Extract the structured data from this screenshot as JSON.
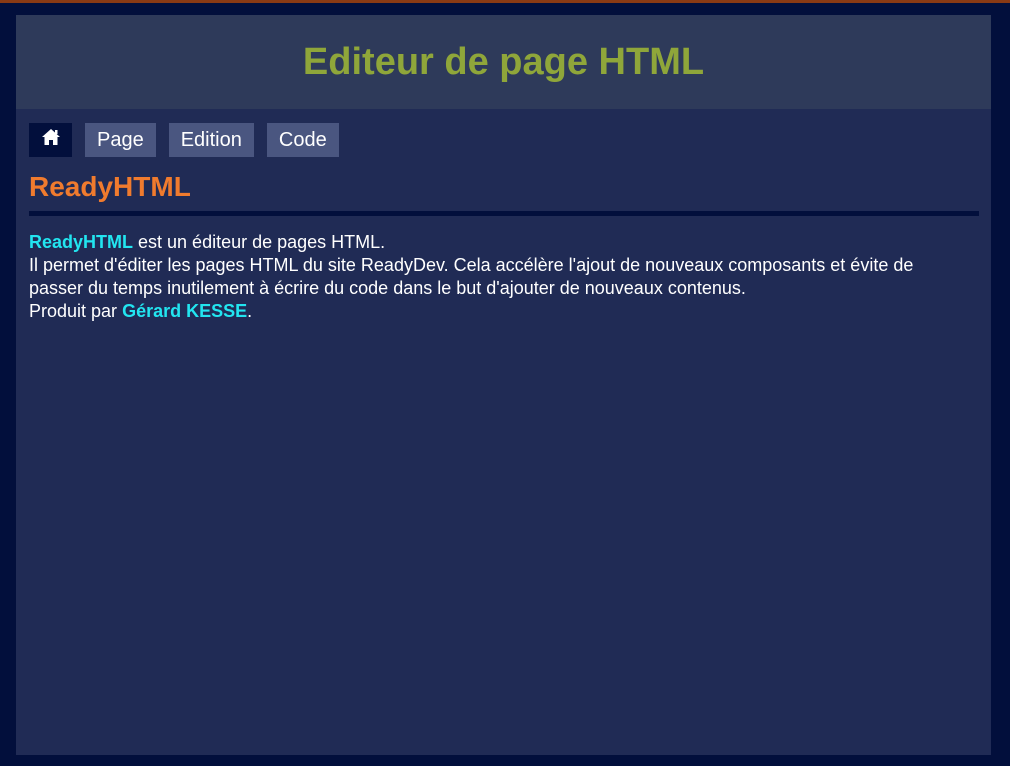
{
  "header": {
    "title": "Editeur de page HTML"
  },
  "nav": {
    "home_icon": "home-icon",
    "items": [
      {
        "label": "Page"
      },
      {
        "label": "Edition"
      },
      {
        "label": "Code"
      }
    ]
  },
  "main": {
    "section_title": "ReadyHTML",
    "intro": {
      "product_name": "ReadyHTML",
      "rest": " est un éditeur de pages HTML."
    },
    "description": "Il permet d'éditer les pages HTML du site ReadyDev. Cela accélère l'ajout de nouveaux composants et évite de passer du temps inutilement à écrire du code dans le but d'ajouter de nouveaux contenus.",
    "credits": {
      "prefix": "Produit par ",
      "author": "Gérard KESSE",
      "suffix": "."
    }
  },
  "colors": {
    "background": "#020f3c",
    "panel": "#202b55",
    "header": "#2e3a5a",
    "title": "#8fa63a",
    "section_title": "#f07b2e",
    "highlight": "#22e5f0",
    "nav_button": "#4a5680"
  }
}
